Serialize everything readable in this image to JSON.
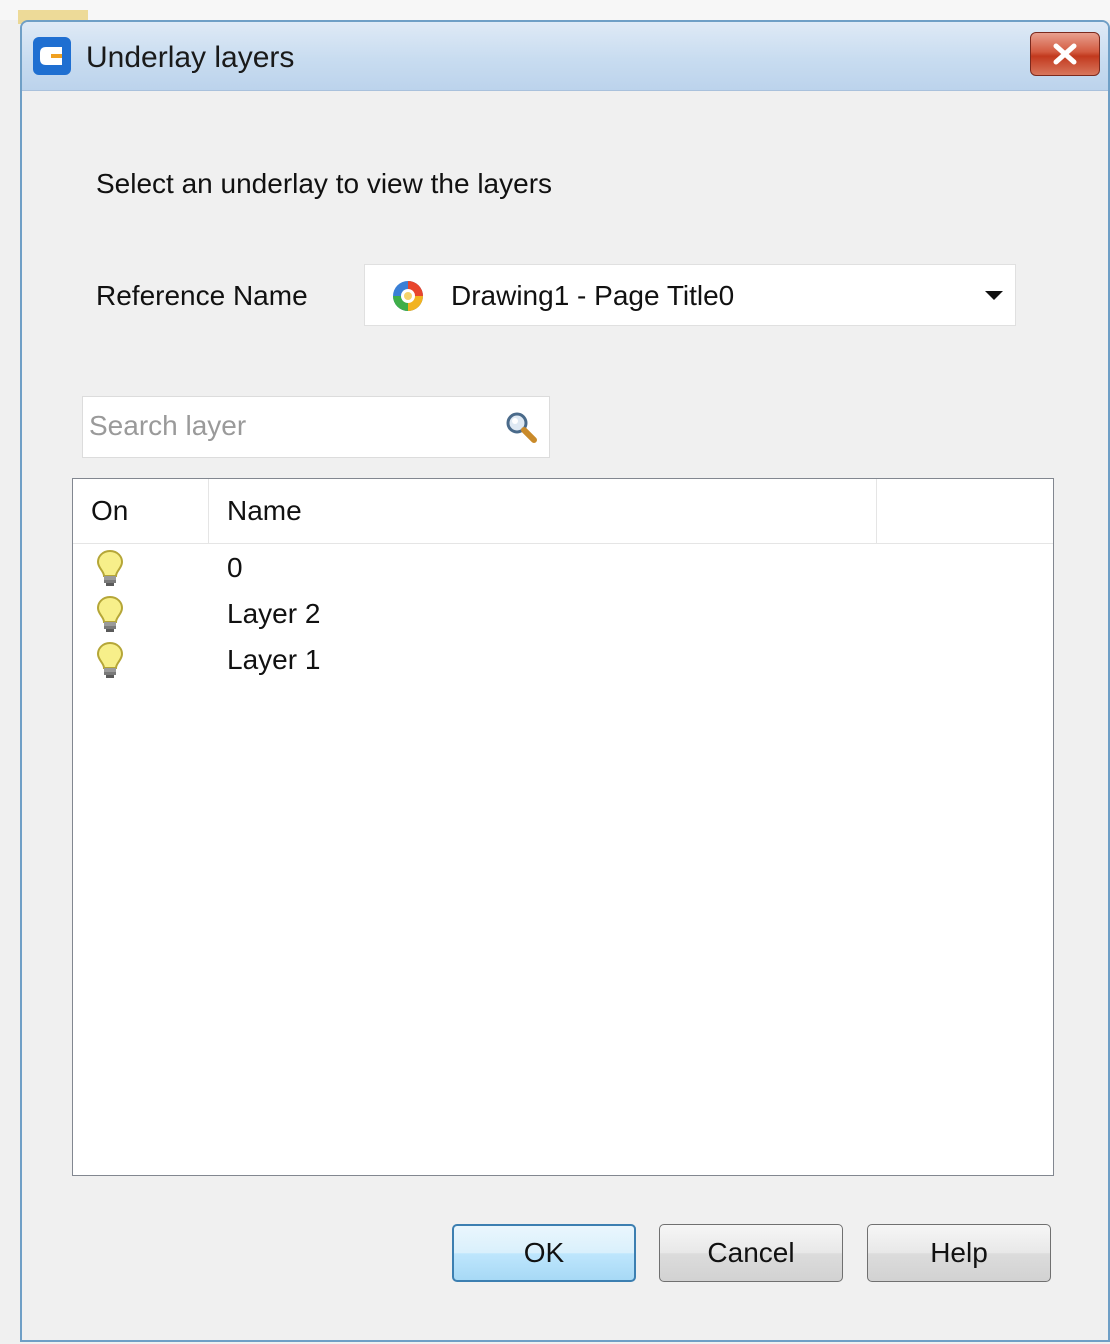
{
  "window": {
    "title": "Underlay layers",
    "close_glyph": "✕"
  },
  "prompt": "Select an underlay to view the layers",
  "reference": {
    "label": "Reference Name",
    "selected": "Drawing1 - Page Title0",
    "icon": "drawing-reference-icon"
  },
  "search": {
    "placeholder": "Search layer",
    "value": "",
    "icon": "magnifier-icon"
  },
  "table": {
    "columns": [
      "On",
      "Name",
      ""
    ],
    "rows": [
      {
        "on": true,
        "name": "0"
      },
      {
        "on": true,
        "name": "Layer 2"
      },
      {
        "on": true,
        "name": "Layer 1"
      }
    ]
  },
  "buttons": {
    "ok": "OK",
    "cancel": "Cancel",
    "help": "Help"
  },
  "colors": {
    "titlebar": "#c8dcf0",
    "dialog_border": "#6f9fc6",
    "close_button": "#c2391e",
    "bulb_on": "#f7ef8a",
    "default_button_border": "#3c7fb1"
  }
}
